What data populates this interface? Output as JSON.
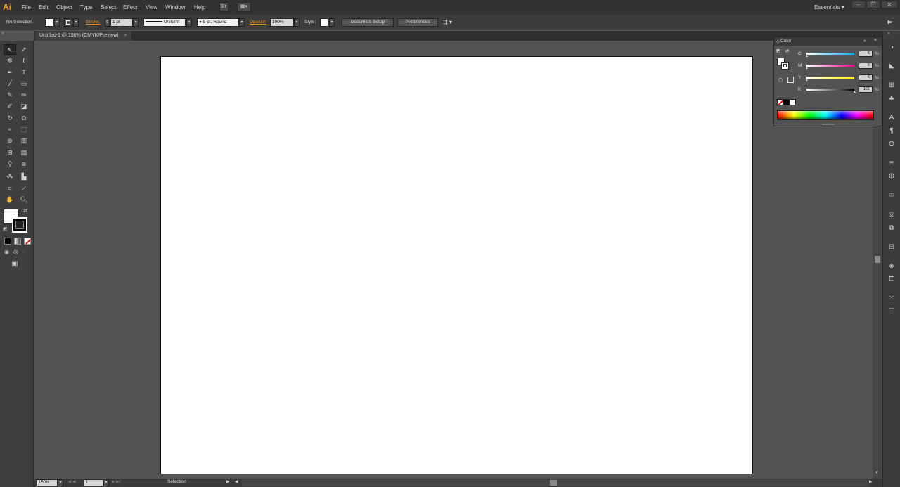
{
  "app": {
    "logo": "Ai"
  },
  "menu": {
    "items": [
      "File",
      "Edit",
      "Object",
      "Type",
      "Select",
      "Effect",
      "View",
      "Window",
      "Help"
    ],
    "bridge_button": "Br",
    "workspace": "Essentials"
  },
  "control_bar": {
    "selection_label": "No Selection",
    "stroke_label": "Stroke:",
    "stroke_weight": "1 pt",
    "stroke_profile": "Uniform",
    "brush": "5 pt. Round",
    "opacity_label": "Opacity:",
    "opacity_value": "100%",
    "style_label": "Style:",
    "document_setup": "Document Setup",
    "preferences": "Preferences"
  },
  "document": {
    "tab_title": "Untitled-1 @ 150% (CMYK/Preview)",
    "close": "×"
  },
  "status": {
    "zoom": "150%",
    "page": "1",
    "tool_name": "Selection"
  },
  "color_panel": {
    "title": "Color",
    "channels": [
      {
        "label": "C",
        "value": "0",
        "unit": "%",
        "color": "#00aeef"
      },
      {
        "label": "M",
        "value": "0",
        "unit": "%",
        "color": "#ec008c"
      },
      {
        "label": "Y",
        "value": "0",
        "unit": "%",
        "color": "#fff200"
      },
      {
        "label": "K",
        "value": "100",
        "unit": "%",
        "color": "#000000"
      }
    ]
  },
  "colors": {
    "brand": "#f39c12",
    "accent": "#e8912d"
  },
  "icons": [
    "selection-tool-icon",
    "direct-selection-tool-icon",
    "magic-wand-icon",
    "lasso-icon",
    "pen-icon",
    "type-icon",
    "line-icon",
    "rectangle-icon",
    "paintbrush-icon",
    "pencil-icon",
    "blob-brush-icon",
    "eraser-icon",
    "rotate-icon",
    "scale-icon",
    "width-icon",
    "free-transform-icon",
    "shape-builder-icon",
    "perspective-grid-icon",
    "mesh-icon",
    "gradient-icon",
    "eyedropper-icon",
    "blend-icon",
    "symbol-sprayer-icon",
    "column-graph-icon",
    "artboard-icon",
    "slice-icon",
    "hand-icon",
    "zoom-icon"
  ]
}
